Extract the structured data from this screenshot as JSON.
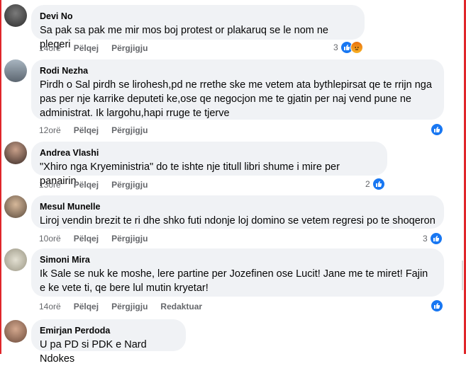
{
  "actions": {
    "like": "Pëlqej",
    "reply": "Përgjigju",
    "edit": "Redaktuar"
  },
  "comments": [
    {
      "name": "Devi No",
      "text": "Sa pak sa pak me mir mos boj protest or plakaruq se le nom ne pleqeri",
      "time": "14orë",
      "reactions_count": "3",
      "reactions": [
        "like",
        "angry"
      ]
    },
    {
      "name": "Rodi Nezha",
      "text": "Pirdh o Sal pirdh se lirohesh,pd ne rrethe ske me vetem ata bythlepirsat qe te rrijn nga pas per nje karrike deputeti ke,ose qe negocjon me te gjatin per naj vend pune ne administrat. Ik largohu,hapi rruge te tjerve",
      "time": "12orë",
      "reactions_count": "",
      "reactions": [
        "like"
      ]
    },
    {
      "name": "Andrea Vlashi",
      "text": "\"Xhiro nga Kryeministria\" do te ishte nje titull libri shume i mire per panairin",
      "time": "13orë",
      "reactions_count": "2",
      "reactions": [
        "like"
      ]
    },
    {
      "name": "Mesul Munelle",
      "text": "Liroj vendin brezit te ri dhe shko futi ndonje loj domino se vetem regresi po te shoqeron",
      "time": "10orë",
      "reactions_count": "3",
      "reactions": [
        "like"
      ]
    },
    {
      "name": "Simoni Mira",
      "text": "Ik Sale se nuk ke moshe, lere partine per Jozefinen ose Lucit! Jane me te miret! Fajin e ke vete ti, qe bere lul mutin kryetar!",
      "time": "14orë",
      "reactions_count": "",
      "reactions": [
        "like"
      ],
      "edited": true
    },
    {
      "name": "Emirjan Perdoda",
      "text": "U pa PD si PDK e Nard Ndokes",
      "time": "",
      "reactions_count": "",
      "reactions": []
    }
  ]
}
